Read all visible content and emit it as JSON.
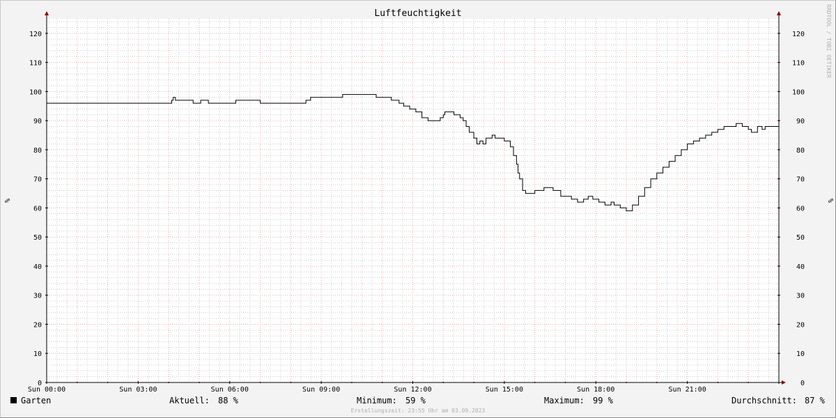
{
  "chart_data": {
    "type": "line",
    "title": "Luftfeuchtigkeit",
    "ylabel_left": "%",
    "ylabel_right": "%",
    "watermark": "RRDTOOL / TOBI OETIKER",
    "x_ticks": [
      "Sun 00:00",
      "Sun 03:00",
      "Sun 06:00",
      "Sun 09:00",
      "Sun 12:00",
      "Sun 15:00",
      "Sun 18:00",
      "Sun 21:00"
    ],
    "x_unit": "hours",
    "xlim": [
      0,
      24
    ],
    "ylim": [
      0,
      125
    ],
    "y_ticks_left": [
      "0",
      "10",
      "20",
      "30",
      "40",
      "50",
      "60",
      "70",
      "80",
      "90",
      "100",
      "110",
      "120"
    ],
    "y_ticks_right": [
      "0",
      "10",
      "20",
      "30",
      "40",
      "50",
      "60",
      "70",
      "80",
      "90",
      "100",
      "110",
      "120"
    ],
    "grid": true,
    "colors": {
      "background": "#f3f3f3",
      "canvas": "#ffffff",
      "line": "#000000",
      "major_grid": "#e0b0b0",
      "minor_grid": "#cccccc",
      "arrow": "#880000"
    },
    "series": [
      {
        "name": "Garten",
        "color": "#000000",
        "x": [
          0,
          3.5,
          4.1,
          4.15,
          4.22,
          4.5,
          4.8,
          5.05,
          5.3,
          5.7,
          5.9,
          6.2,
          6.5,
          6.8,
          7.0,
          7.1,
          7.35,
          7.5,
          7.8,
          8.0,
          8.5,
          8.65,
          8.8,
          9.0,
          9.5,
          9.7,
          10.0,
          10.5,
          10.8,
          11.1,
          11.3,
          11.5,
          11.55,
          11.7,
          11.9,
          12.0,
          12.1,
          12.3,
          12.5,
          12.8,
          12.9,
          13.0,
          13.05,
          13.15,
          13.25,
          13.35,
          13.45,
          13.55,
          13.65,
          13.75,
          13.85,
          14.0,
          14.1,
          14.2,
          14.3,
          14.4,
          14.5,
          14.6,
          14.7,
          14.8,
          15.0,
          15.2,
          15.3,
          15.4,
          15.45,
          15.5,
          15.6,
          15.7,
          15.8,
          15.9,
          16.0,
          16.3,
          16.6,
          16.85,
          17.0,
          17.2,
          17.4,
          17.6,
          17.75,
          17.9,
          18.1,
          18.3,
          18.5,
          18.6,
          18.8,
          19.0,
          19.2,
          19.4,
          19.6,
          19.8,
          20.0,
          20.2,
          20.4,
          20.6,
          20.8,
          21.0,
          21.2,
          21.4,
          21.6,
          21.8,
          22.0,
          22.2,
          22.4,
          22.6,
          22.8,
          23.0,
          23.1,
          23.3,
          23.45,
          23.55,
          23.7,
          23.99
        ],
        "values": [
          96,
          96,
          97,
          98,
          97,
          97,
          96,
          97,
          96,
          96,
          96,
          97,
          97,
          97,
          96,
          96,
          96,
          96,
          96,
          96,
          97,
          98,
          98,
          98,
          98,
          99,
          99,
          99,
          98,
          98,
          97,
          97,
          96,
          95,
          94,
          94,
          93,
          91,
          90,
          90,
          91,
          92,
          93,
          93,
          93,
          92,
          92,
          91,
          90,
          88,
          86,
          84,
          82,
          83,
          82,
          84,
          84,
          85,
          84,
          84,
          83,
          81,
          78,
          75,
          72,
          70,
          66,
          65,
          65,
          65,
          66,
          67,
          66,
          64,
          64,
          63,
          62,
          63,
          64,
          63,
          62,
          61,
          62,
          61,
          60,
          59,
          61,
          64,
          67,
          70,
          72,
          74,
          76,
          78,
          80,
          82,
          83,
          84,
          85,
          86,
          87,
          88,
          88,
          89,
          88,
          87,
          86,
          88,
          87,
          88,
          88,
          88
        ]
      }
    ]
  },
  "legend": {
    "series_name": "Garten",
    "aktuell_label": "Aktuell:",
    "aktuell_value": "88 %",
    "minimum_label": "Minimum:",
    "minimum_value": "59 %",
    "maximum_label": "Maximum:",
    "maximum_value": "99 %",
    "durchschnitt_label": "Durchschnitt:",
    "durchschnitt_value": "87 %"
  },
  "footer": "Erstellungszeit: 23:55 Uhr am 03.09.2023"
}
